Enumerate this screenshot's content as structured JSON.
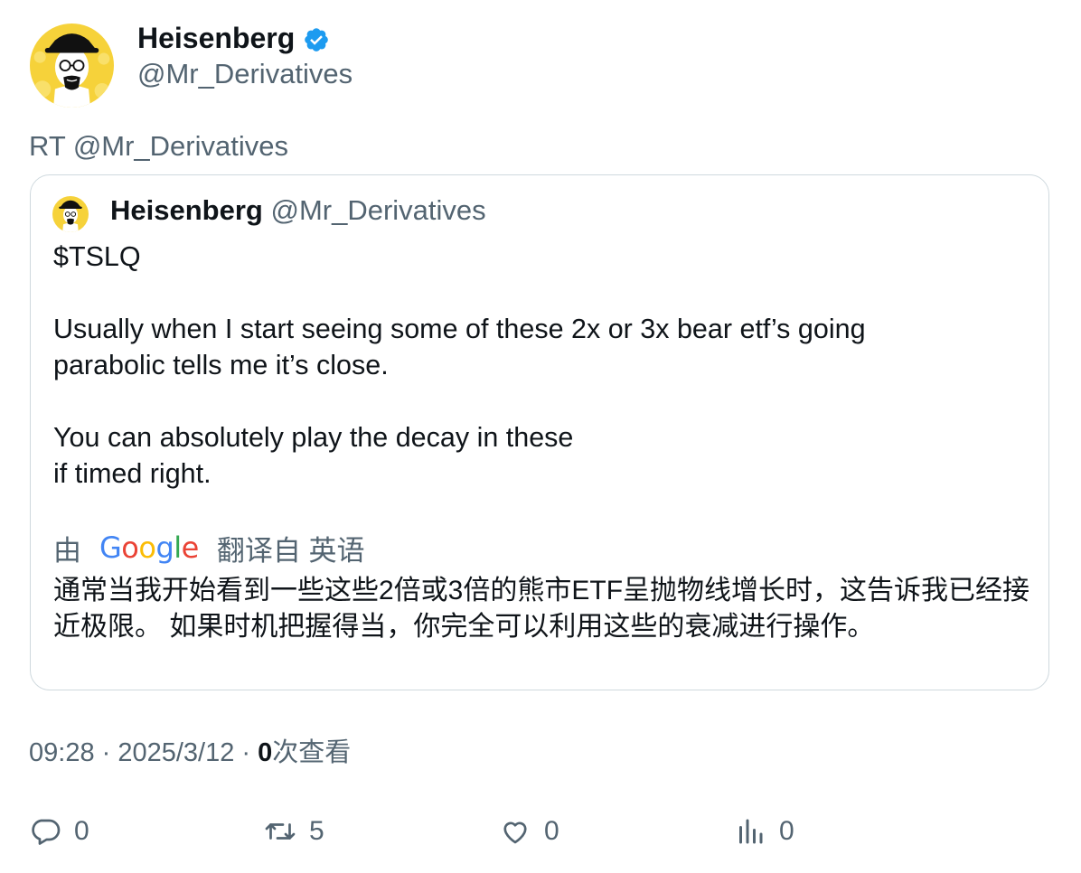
{
  "tweet": {
    "author": {
      "name": "Heisenberg",
      "handle": "@Mr_Derivatives",
      "verified": true
    },
    "retweet_label": "RT @Mr_Derivatives",
    "quoted": {
      "author_name": "Heisenberg",
      "author_handle": "@Mr_Derivatives",
      "text": "$TSLQ\n\nUsually when I start seeing some of these 2x or 3x bear etf’s going\nparabolic tells me it’s close.\n\nYou can absolutely play the decay in these\nif timed right.",
      "translation": {
        "prefix": "由",
        "provider": "Google",
        "suffix": "翻译自 英语",
        "text": "通常当我开始看到一些这些2倍或3倍的熊市ETF呈抛物线增长时，这告诉我已经接近极限。 如果时机把握得当，你完全可以利用这些的衰减进行操作。"
      }
    },
    "meta": {
      "time": "09:28",
      "sep1": " · ",
      "date": "2025/3/12",
      "sep2": " · ",
      "views_count": "0",
      "views_label": "次查看"
    },
    "actions": {
      "replies": "0",
      "retweets": "5",
      "likes": "0",
      "views": "0"
    }
  },
  "colors": {
    "text": "#0f1419",
    "secondary": "#536471",
    "border": "#cfd9de",
    "verified": "#1d9bf0"
  },
  "icons": [
    "avatar-heisenberg",
    "verified-badge-icon",
    "reply-icon",
    "retweet-icon",
    "like-icon",
    "views-chart-icon"
  ]
}
